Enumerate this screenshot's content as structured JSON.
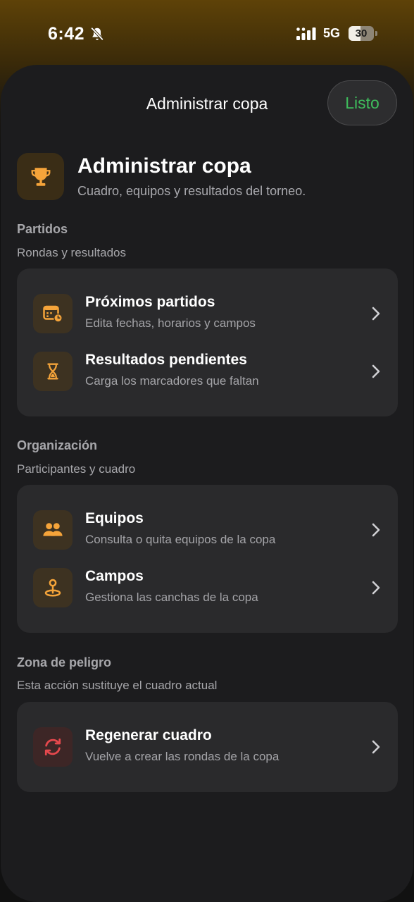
{
  "status_bar": {
    "time": "6:42",
    "network": "5G",
    "battery": "30",
    "icons": [
      "bell-slash-icon",
      "signal-icon"
    ]
  },
  "sheet": {
    "title": "Administrar copa",
    "done_label": "Listo"
  },
  "hero": {
    "icon": "trophy-icon",
    "title": "Administrar copa",
    "subtitle": "Cuadro, equipos y resultados del torneo."
  },
  "sections": [
    {
      "title": "Partidos",
      "subtitle": "Rondas y resultados",
      "rows": [
        {
          "icon": "calendar-clock-icon",
          "title": "Próximos partidos",
          "subtitle": "Edita fechas, horarios y campos"
        },
        {
          "icon": "hourglass-icon",
          "title": "Resultados pendientes",
          "subtitle": "Carga los marcadores que faltan"
        }
      ]
    },
    {
      "title": "Organización",
      "subtitle": "Participantes y cuadro",
      "rows": [
        {
          "icon": "people-icon",
          "title": "Equipos",
          "subtitle": "Consulta o quita equipos de la copa"
        },
        {
          "icon": "location-pin-icon",
          "title": "Campos",
          "subtitle": "Gestiona las canchas de la copa"
        }
      ]
    },
    {
      "title": "Zona de peligro",
      "subtitle": "Esta acción sustituye el cuadro actual",
      "rows": [
        {
          "icon": "refresh-icon",
          "title": "Regenerar cuadro",
          "subtitle": "Vuelve a crear las rondas de la copa"
        }
      ]
    }
  ],
  "colors": {
    "accent_orange": "#f5a43a",
    "danger_red": "#e5484d",
    "done_green": "#3fbd5c",
    "sheet_bg": "#1c1c1e",
    "card_bg": "#2a2a2c"
  }
}
